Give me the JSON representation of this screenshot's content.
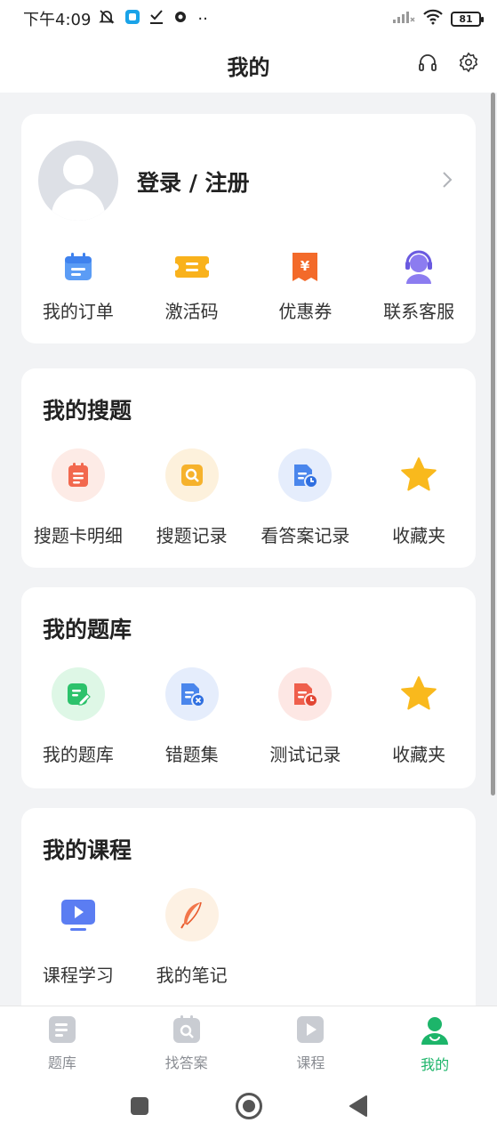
{
  "status": {
    "time": "下午4:09",
    "battery": "81"
  },
  "header": {
    "title": "我的"
  },
  "profile": {
    "login_label": "登录 / 注册",
    "shortcuts": [
      {
        "label": "我的订单",
        "icon": "calendar-order-icon"
      },
      {
        "label": "激活码",
        "icon": "ticket-code-icon"
      },
      {
        "label": "优惠券",
        "icon": "yuan-coupon-icon"
      },
      {
        "label": "联系客服",
        "icon": "headset-agent-icon"
      }
    ]
  },
  "search_section": {
    "title": "我的搜题",
    "items": [
      {
        "label": "搜题卡明细",
        "icon": "notepad-icon"
      },
      {
        "label": "搜题记录",
        "icon": "search-doc-icon"
      },
      {
        "label": "看答案记录",
        "icon": "doc-clock-icon"
      },
      {
        "label": "收藏夹",
        "icon": "star-icon"
      }
    ]
  },
  "bank_section": {
    "title": "我的题库",
    "items": [
      {
        "label": "我的题库",
        "icon": "edit-doc-icon"
      },
      {
        "label": "错题集",
        "icon": "doc-error-icon"
      },
      {
        "label": "测试记录",
        "icon": "doc-clock-icon"
      },
      {
        "label": "收藏夹",
        "icon": "star-icon"
      }
    ]
  },
  "course_section": {
    "title": "我的课程",
    "items": [
      {
        "label": "课程学习",
        "icon": "play-screen-icon"
      },
      {
        "label": "我的笔记",
        "icon": "feather-icon"
      }
    ]
  },
  "tabbar": {
    "items": [
      {
        "label": "题库"
      },
      {
        "label": "找答案"
      },
      {
        "label": "课程"
      },
      {
        "label": "我的"
      }
    ],
    "active_color": "#1db56a"
  }
}
